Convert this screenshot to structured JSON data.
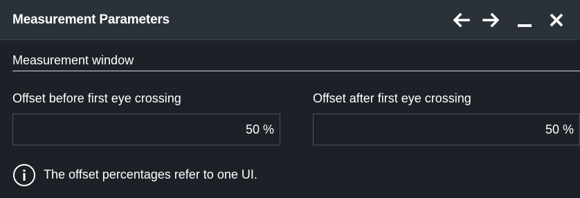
{
  "window": {
    "title": "Measurement Parameters",
    "controls": {
      "back": "arrow-left-icon",
      "forward": "arrow-right-icon",
      "minimize": "minimize-icon",
      "close": "close-icon"
    }
  },
  "section": {
    "title": "Measurement window"
  },
  "fields": {
    "before": {
      "label": "Offset before first eye crossing",
      "value": "50 %"
    },
    "after": {
      "label": "Offset after first eye crossing",
      "value": "50 %"
    }
  },
  "info": {
    "icon": "info-icon",
    "text": "The offset percentages refer to one UI."
  },
  "colors": {
    "background": "#1c2127",
    "titlebar": "#2a3139",
    "input_border": "#4c545d",
    "text": "#ffffff"
  }
}
